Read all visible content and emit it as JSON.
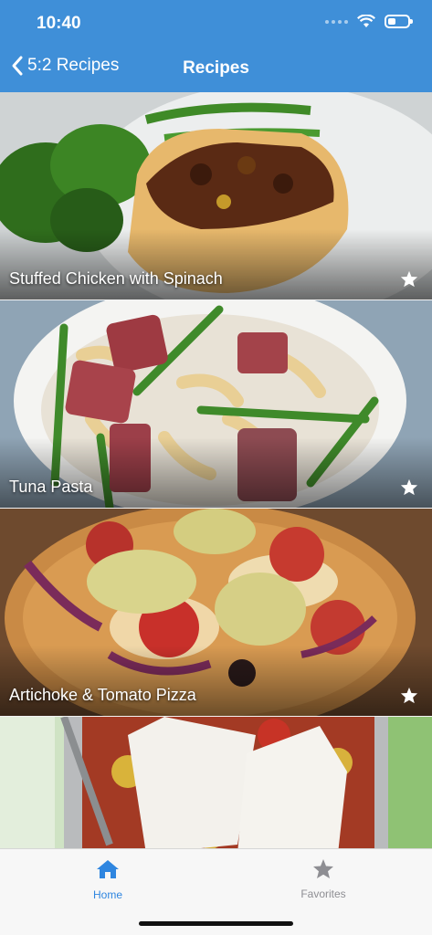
{
  "status_bar": {
    "time": "10:40",
    "battery_level": 0.4
  },
  "nav": {
    "back_label": "5:2 Recipes",
    "title": "Recipes"
  },
  "recipes": [
    {
      "title": "Stuffed Chicken with Spinach"
    },
    {
      "title": "Tuna Pasta"
    },
    {
      "title": "Artichoke & Tomato Pizza"
    },
    {
      "title": ""
    }
  ],
  "tabbar": {
    "home_label": "Home",
    "favorites_label": "Favorites",
    "active_color": "#2f86e0",
    "inactive_color": "#8e8e93"
  },
  "colors": {
    "header": "#3f8fd8"
  }
}
